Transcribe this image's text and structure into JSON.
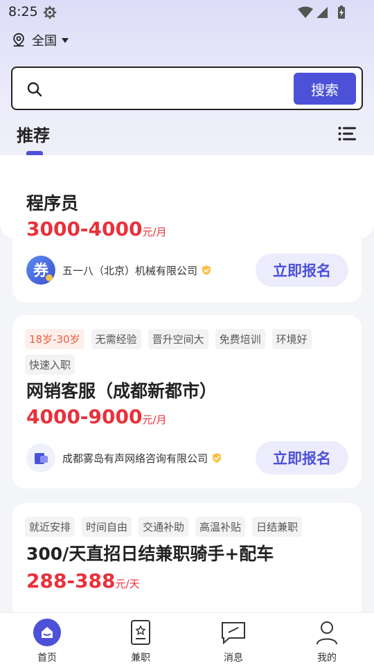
{
  "status": {
    "time": "8:25"
  },
  "location": {
    "label": "全国"
  },
  "search": {
    "placeholder": "",
    "button": "搜索"
  },
  "section": {
    "title": "推荐"
  },
  "jobs": [
    {
      "title": "程序员",
      "salary": "3000-4000",
      "salary_unit": "元/月",
      "company": "五一八（北京）机械有限公司",
      "logo_text": "券",
      "apply": "立即报名",
      "tags": []
    },
    {
      "title": "网销客服（成都新都市）",
      "salary": "4000-9000",
      "salary_unit": "元/月",
      "company": "成都雾岛有声网络咨询有限公司",
      "apply": "立即报名",
      "tags": [
        "18岁-30岁",
        "无需经验",
        "晋升空间大",
        "免费培训",
        "环境好",
        "快速入职"
      ]
    },
    {
      "title": "300/天直招日结兼职骑手+配车",
      "salary": "288-388",
      "salary_unit": "元/天",
      "tags": [
        "就近安排",
        "时间自由",
        "交通补助",
        "高温补贴",
        "日结兼职"
      ]
    }
  ],
  "nav": [
    {
      "label": "首页",
      "icon": "home-icon"
    },
    {
      "label": "兼职",
      "icon": "parttime-icon"
    },
    {
      "label": "消息",
      "icon": "message-icon"
    },
    {
      "label": "我的",
      "icon": "profile-icon"
    }
  ],
  "colors": {
    "accent": "#4c51d8",
    "salary": "#e8313b"
  }
}
